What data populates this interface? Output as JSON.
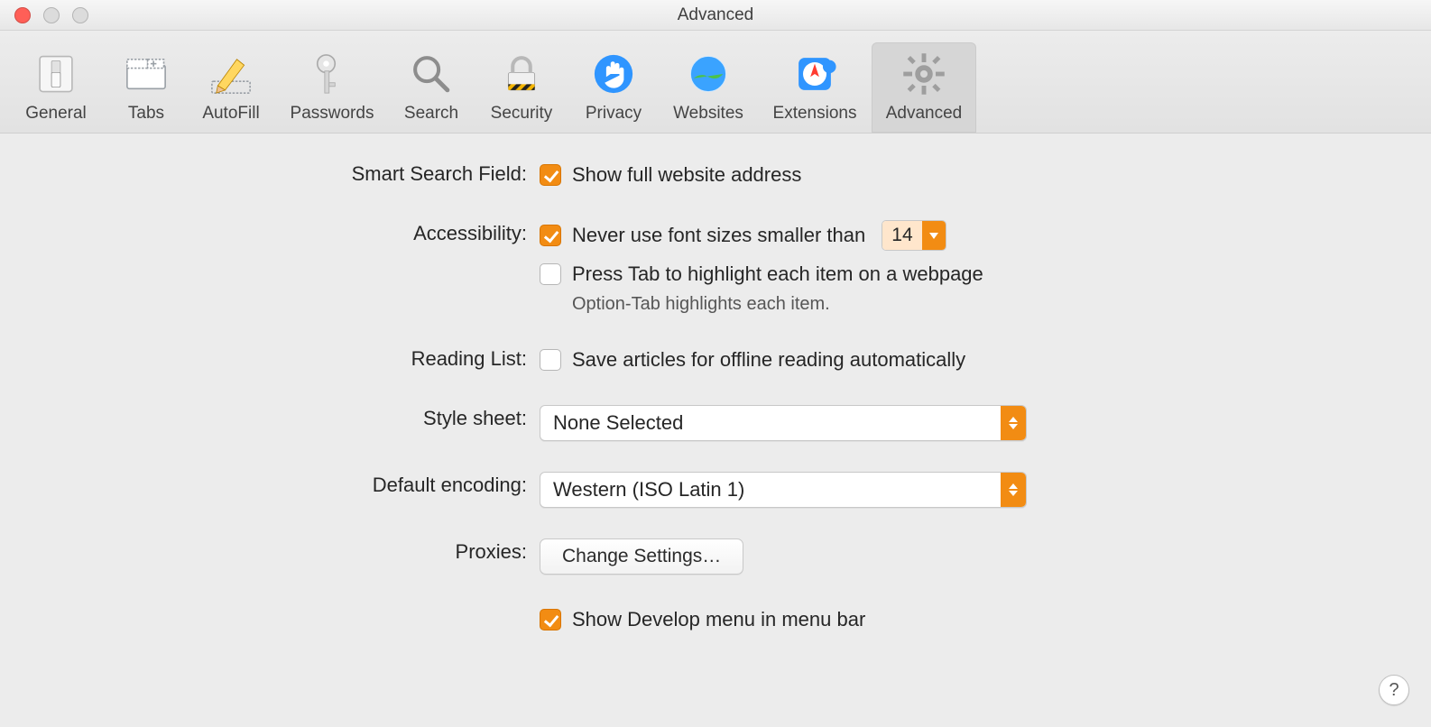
{
  "window": {
    "title": "Advanced"
  },
  "toolbar": {
    "items": [
      {
        "label": "General",
        "icon": "switch-icon",
        "selected": false
      },
      {
        "label": "Tabs",
        "icon": "tabs-icon",
        "selected": false
      },
      {
        "label": "AutoFill",
        "icon": "pencil-icon",
        "selected": false
      },
      {
        "label": "Passwords",
        "icon": "key-icon",
        "selected": false
      },
      {
        "label": "Search",
        "icon": "magnifier-icon",
        "selected": false
      },
      {
        "label": "Security",
        "icon": "lock-icon",
        "selected": false
      },
      {
        "label": "Privacy",
        "icon": "hand-icon",
        "selected": false
      },
      {
        "label": "Websites",
        "icon": "globe-icon",
        "selected": false
      },
      {
        "label": "Extensions",
        "icon": "compass-puzzle-icon",
        "selected": false
      },
      {
        "label": "Advanced",
        "icon": "gear-icon",
        "selected": true
      }
    ]
  },
  "sections": {
    "smartSearch": {
      "label": "Smart Search Field:",
      "showFullAddress": {
        "checked": true,
        "text": "Show full website address"
      }
    },
    "accessibility": {
      "label": "Accessibility:",
      "minFont": {
        "checked": true,
        "text": "Never use font sizes smaller than",
        "value": "14"
      },
      "pressTab": {
        "checked": false,
        "text": "Press Tab to highlight each item on a webpage"
      },
      "hint": "Option-Tab highlights each item."
    },
    "readingList": {
      "label": "Reading List:",
      "saveOffline": {
        "checked": false,
        "text": "Save articles for offline reading automatically"
      }
    },
    "styleSheet": {
      "label": "Style sheet:",
      "value": "None Selected"
    },
    "encoding": {
      "label": "Default encoding:",
      "value": "Western (ISO Latin 1)"
    },
    "proxies": {
      "label": "Proxies:",
      "button": "Change Settings…"
    },
    "develop": {
      "checked": true,
      "text": "Show Develop menu in menu bar"
    }
  },
  "help": "?"
}
